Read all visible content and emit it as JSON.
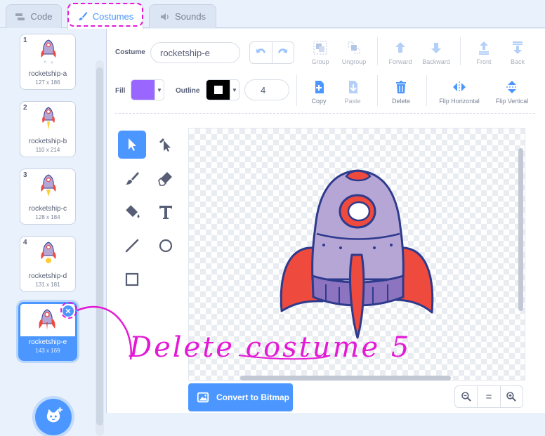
{
  "tabs": [
    {
      "label": "Code",
      "icon": "code-blocks-icon"
    },
    {
      "label": "Costumes",
      "icon": "paintbrush-icon",
      "active": true
    },
    {
      "label": "Sounds",
      "icon": "speaker-icon"
    }
  ],
  "costumes": [
    {
      "number": "1",
      "name": "rocketship-a",
      "size": "127 x 186"
    },
    {
      "number": "2",
      "name": "rocketship-b",
      "size": "110 x 214"
    },
    {
      "number": "3",
      "name": "rocketship-c",
      "size": "128 x 184"
    },
    {
      "number": "4",
      "name": "rocketship-d",
      "size": "131 x 181"
    },
    {
      "number": "5",
      "name": "rocketship-e",
      "size": "143 x 169",
      "selected": true
    }
  ],
  "editor": {
    "costume_label": "Costume",
    "costume_name": "rocketship-e",
    "fill_label": "Fill",
    "fill_color": "#9966ff",
    "outline_label": "Outline",
    "outline_color": "#000000",
    "outline_width": "4",
    "buttons": {
      "group": "Group",
      "ungroup": "Ungroup",
      "forward": "Forward",
      "backward": "Backward",
      "front": "Front",
      "back": "Back",
      "copy": "Copy",
      "paste": "Paste",
      "delete": "Delete",
      "flip_horizontal": "Flip Horizontal",
      "flip_vertical": "Flip Vertical"
    },
    "convert_label": "Convert to Bitmap",
    "zoom": {
      "out": "−",
      "reset": "=",
      "in": "+"
    }
  },
  "annotation": "Delete costume 5",
  "colors": {
    "accent": "#4c97ff",
    "annotation": "#e419d6",
    "rocket_body": "#b6a6d6",
    "rocket_fins": "#ef4a3e",
    "rocket_outline": "#2e3a8c"
  }
}
